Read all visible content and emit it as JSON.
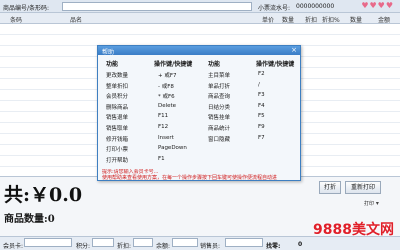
{
  "search": {
    "barcode_label": "商品编号/条形码:",
    "member_label": "小票流水号:",
    "member_value": "0000000000",
    "hearts": "♥♥♥♥"
  },
  "grid": {
    "columns": [
      "条码",
      "品名",
      "单价",
      "数量",
      "折扣",
      "折扣%",
      "数量",
      "金额"
    ]
  },
  "summary": {
    "total_text": "共:￥0.0",
    "qty_label": "商品数量:",
    "qty_value": "0"
  },
  "buttons": {
    "print": "打折",
    "reprint": "重新打印"
  },
  "bottom": {
    "member_card": "会员卡:",
    "points": "积分:",
    "discount": "折扣:",
    "balance": "余额:",
    "salesperson": "销售员:",
    "change": "找零:",
    "change_value": "0",
    "print_label": "打印"
  },
  "dialog": {
    "title": "帮助",
    "close": "×",
    "headers": [
      "功能",
      "操作键/快捷键",
      "功能",
      "操作键/快捷键"
    ],
    "left_rows": [
      {
        "fn": "更改数量",
        "key": "+ 或F7"
      },
      {
        "fn": "整单折扣",
        "key": "- 或F8"
      },
      {
        "fn": "会员积分",
        "key": "* 或F6"
      },
      {
        "fn": "删除商品",
        "key": "Delete"
      },
      {
        "fn": "销售退单",
        "key": "F11"
      },
      {
        "fn": "销售取单",
        "key": "F12"
      },
      {
        "fn": "修开钱箱",
        "key": "Insert"
      },
      {
        "fn": "打印小票",
        "key": "PageDown"
      },
      {
        "fn": "打开帮助",
        "key": "F1"
      }
    ],
    "right_rows": [
      {
        "fn": "主目菜单",
        "key": "F2"
      },
      {
        "fn": "单品打折",
        "key": "/"
      },
      {
        "fn": "商品查询",
        "key": "F3"
      },
      {
        "fn": "日结分类",
        "key": "F4"
      },
      {
        "fn": "销售挂单",
        "key": "F5"
      },
      {
        "fn": "商品统计",
        "key": "F9"
      },
      {
        "fn": "窗口隐藏",
        "key": "F7"
      }
    ],
    "tip_line1": "提示:请您输入会员卡号...",
    "tip_line2": "使用帮助来查看使用方案，在每一个操作步骤按下回车键可使操作便流程自动进"
  },
  "watermark": "9888美文网"
}
